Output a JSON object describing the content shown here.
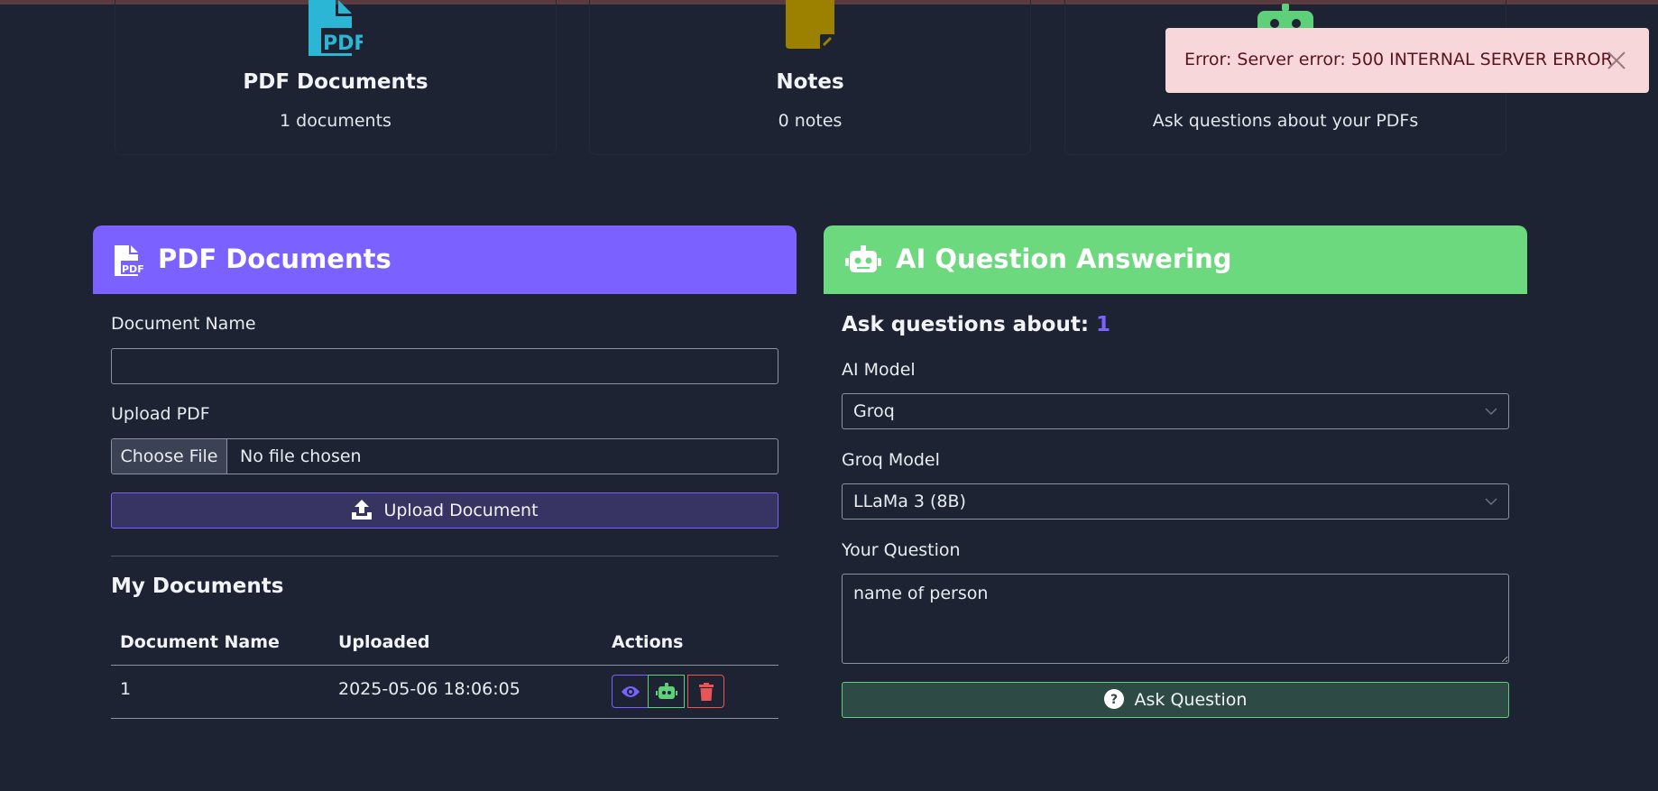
{
  "stats": [
    {
      "title": "PDF Documents",
      "subtitle": "1 documents",
      "icon": "pdf-file-icon"
    },
    {
      "title": "Notes",
      "subtitle": "0 notes",
      "icon": "note-icon"
    },
    {
      "title": "",
      "subtitle": "Ask questions about your PDFs",
      "icon": "robot-icon"
    }
  ],
  "toast": {
    "message": "Error: Server error: 500 INTERNAL SERVER ERROR",
    "type": "error"
  },
  "pdf_panel": {
    "title": "PDF Documents",
    "doc_name_label": "Document Name",
    "doc_name_value": "",
    "upload_label": "Upload PDF",
    "choose_file_label": "Choose File",
    "no_file_text": "No file chosen",
    "upload_button": "Upload Document",
    "my_docs_title": "My Documents",
    "table": {
      "headers": [
        "Document Name",
        "Uploaded",
        "Actions"
      ],
      "rows": [
        {
          "name": "1",
          "uploaded": "2025-05-06 18:06:05",
          "actions": [
            "view",
            "ask-ai",
            "delete"
          ]
        }
      ]
    }
  },
  "ai_panel": {
    "title": "AI Question Answering",
    "ask_about_prefix": "Ask questions about:",
    "ask_about_doc": "1",
    "model_label": "AI Model",
    "model_value": "Groq",
    "groq_model_label": "Groq Model",
    "groq_model_value": "LLaMa 3 (8B)",
    "question_label": "Your Question",
    "question_value": "name of person",
    "ask_button": "Ask Question"
  },
  "colors": {
    "background": "#1d2333",
    "pdf_header": "#7b61ff",
    "ai_header": "#6cd97e",
    "pdf_icon": "#2bb6d6",
    "note_icon": "#9c8000",
    "robot_icon": "#5fd07a",
    "error_bg": "#f8d7da",
    "error_text": "#58151c",
    "delete": "#ea5455"
  }
}
